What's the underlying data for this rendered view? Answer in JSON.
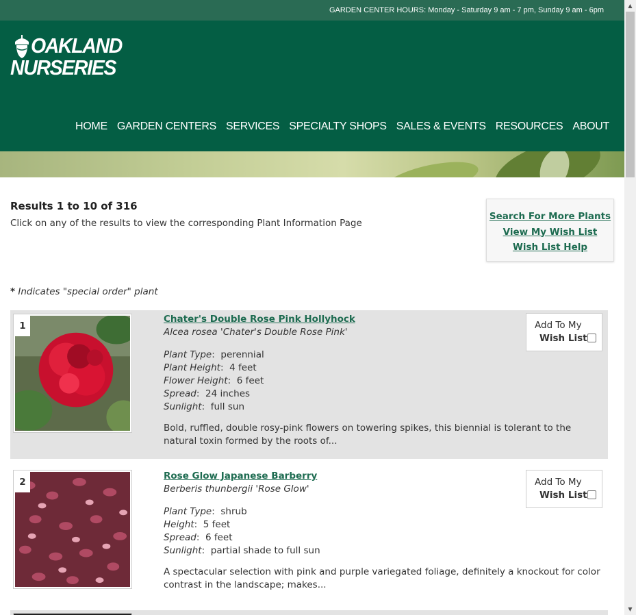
{
  "topbar": {
    "hours": "GARDEN CENTER HOURS: Monday - Saturday 9 am - 7 pm, Sunday 9 am - 6pm"
  },
  "logo": {
    "line1": "OAKLAND",
    "line2": "NURSERIES"
  },
  "nav": [
    "HOME",
    "GARDEN CENTERS",
    "SERVICES",
    "SPECIALTY SHOPS",
    "SALES & EVENTS",
    "RESOURCES",
    "ABOUT"
  ],
  "results": {
    "title": "Results 1 to 10 of 316",
    "subtitle": "Click on any of the results to view the corresponding Plant Information Page"
  },
  "search_box": {
    "search_more": "Search For More Plants",
    "view_wish": "View My Wish List",
    "wish_help": "Wish List Help"
  },
  "special_note": {
    "star": "*",
    "text": " Indicates \"special order\" plant"
  },
  "wish_labels": {
    "line1": "Add To My",
    "line2": "Wish List"
  },
  "plants": [
    {
      "num": "1",
      "name": "Chater's Double Rose Pink Hollyhock",
      "botanical": "Alcea rosea 'Chater's Double Rose Pink'",
      "attrs": [
        {
          "label": "Plant Type",
          "value": "perennial"
        },
        {
          "label": "Plant Height",
          "value": "4 feet"
        },
        {
          "label": "Flower Height",
          "value": "6 feet"
        },
        {
          "label": "Spread",
          "value": "24 inches"
        },
        {
          "label": "Sunlight",
          "value": "full sun"
        }
      ],
      "desc": "Bold, ruffled, double rosy-pink flowers on towering spikes, this biennial is tolerant to the natural toxin formed by the roots of...",
      "wish_checked": false
    },
    {
      "num": "2",
      "name": "Rose Glow Japanese Barberry",
      "botanical": "Berberis thunbergii 'Rose Glow'",
      "attrs": [
        {
          "label": "Plant Type",
          "value": "shrub"
        },
        {
          "label": "Height",
          "value": "5 feet"
        },
        {
          "label": "Spread",
          "value": "6 feet"
        },
        {
          "label": "Sunlight",
          "value": "partial shade to full sun"
        }
      ],
      "desc": "A spectacular selection with pink and purple variegated foliage, definitely a knockout for color contrast in the landscape; makes...",
      "wish_checked": false
    }
  ],
  "colors": {
    "header": "#045e44",
    "topbar": "#2a6b54",
    "link": "#1d6b50",
    "row_shade": "#e3e3e3"
  }
}
